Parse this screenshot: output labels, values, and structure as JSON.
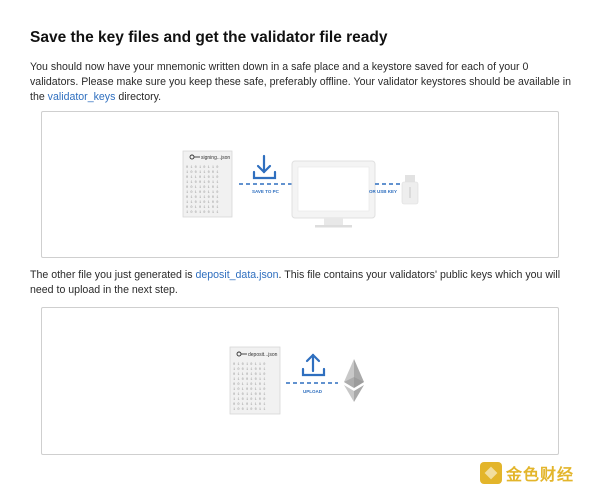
{
  "title": "Save the key files and get the validator file ready",
  "para1": {
    "text_before": "You should now have your mnemonic written down in a safe place and a keystore saved for each of your 0 validators. Please make sure you keep these safe, preferably offline. Your validator keystores should be available in the ",
    "link": "validator_keys",
    "text_after": " directory."
  },
  "para2": {
    "text_before": "The other file you just generated is ",
    "link": "deposit_data.json",
    "text_after": ". This file contains your validators' public keys which you will need to upload in the next step."
  },
  "illustration1": {
    "file_label": "signing...json",
    "save_label": "SAVE TO PC",
    "usb_label": "OR USB KEY"
  },
  "illustration2": {
    "file_label": "deposit...json",
    "upload_label": "UPLOAD"
  },
  "watermark": {
    "text": "金色财经"
  },
  "colors": {
    "accent": "#2f6fbf",
    "border": "#cfcfcf",
    "watermark": "#e3b52b"
  }
}
